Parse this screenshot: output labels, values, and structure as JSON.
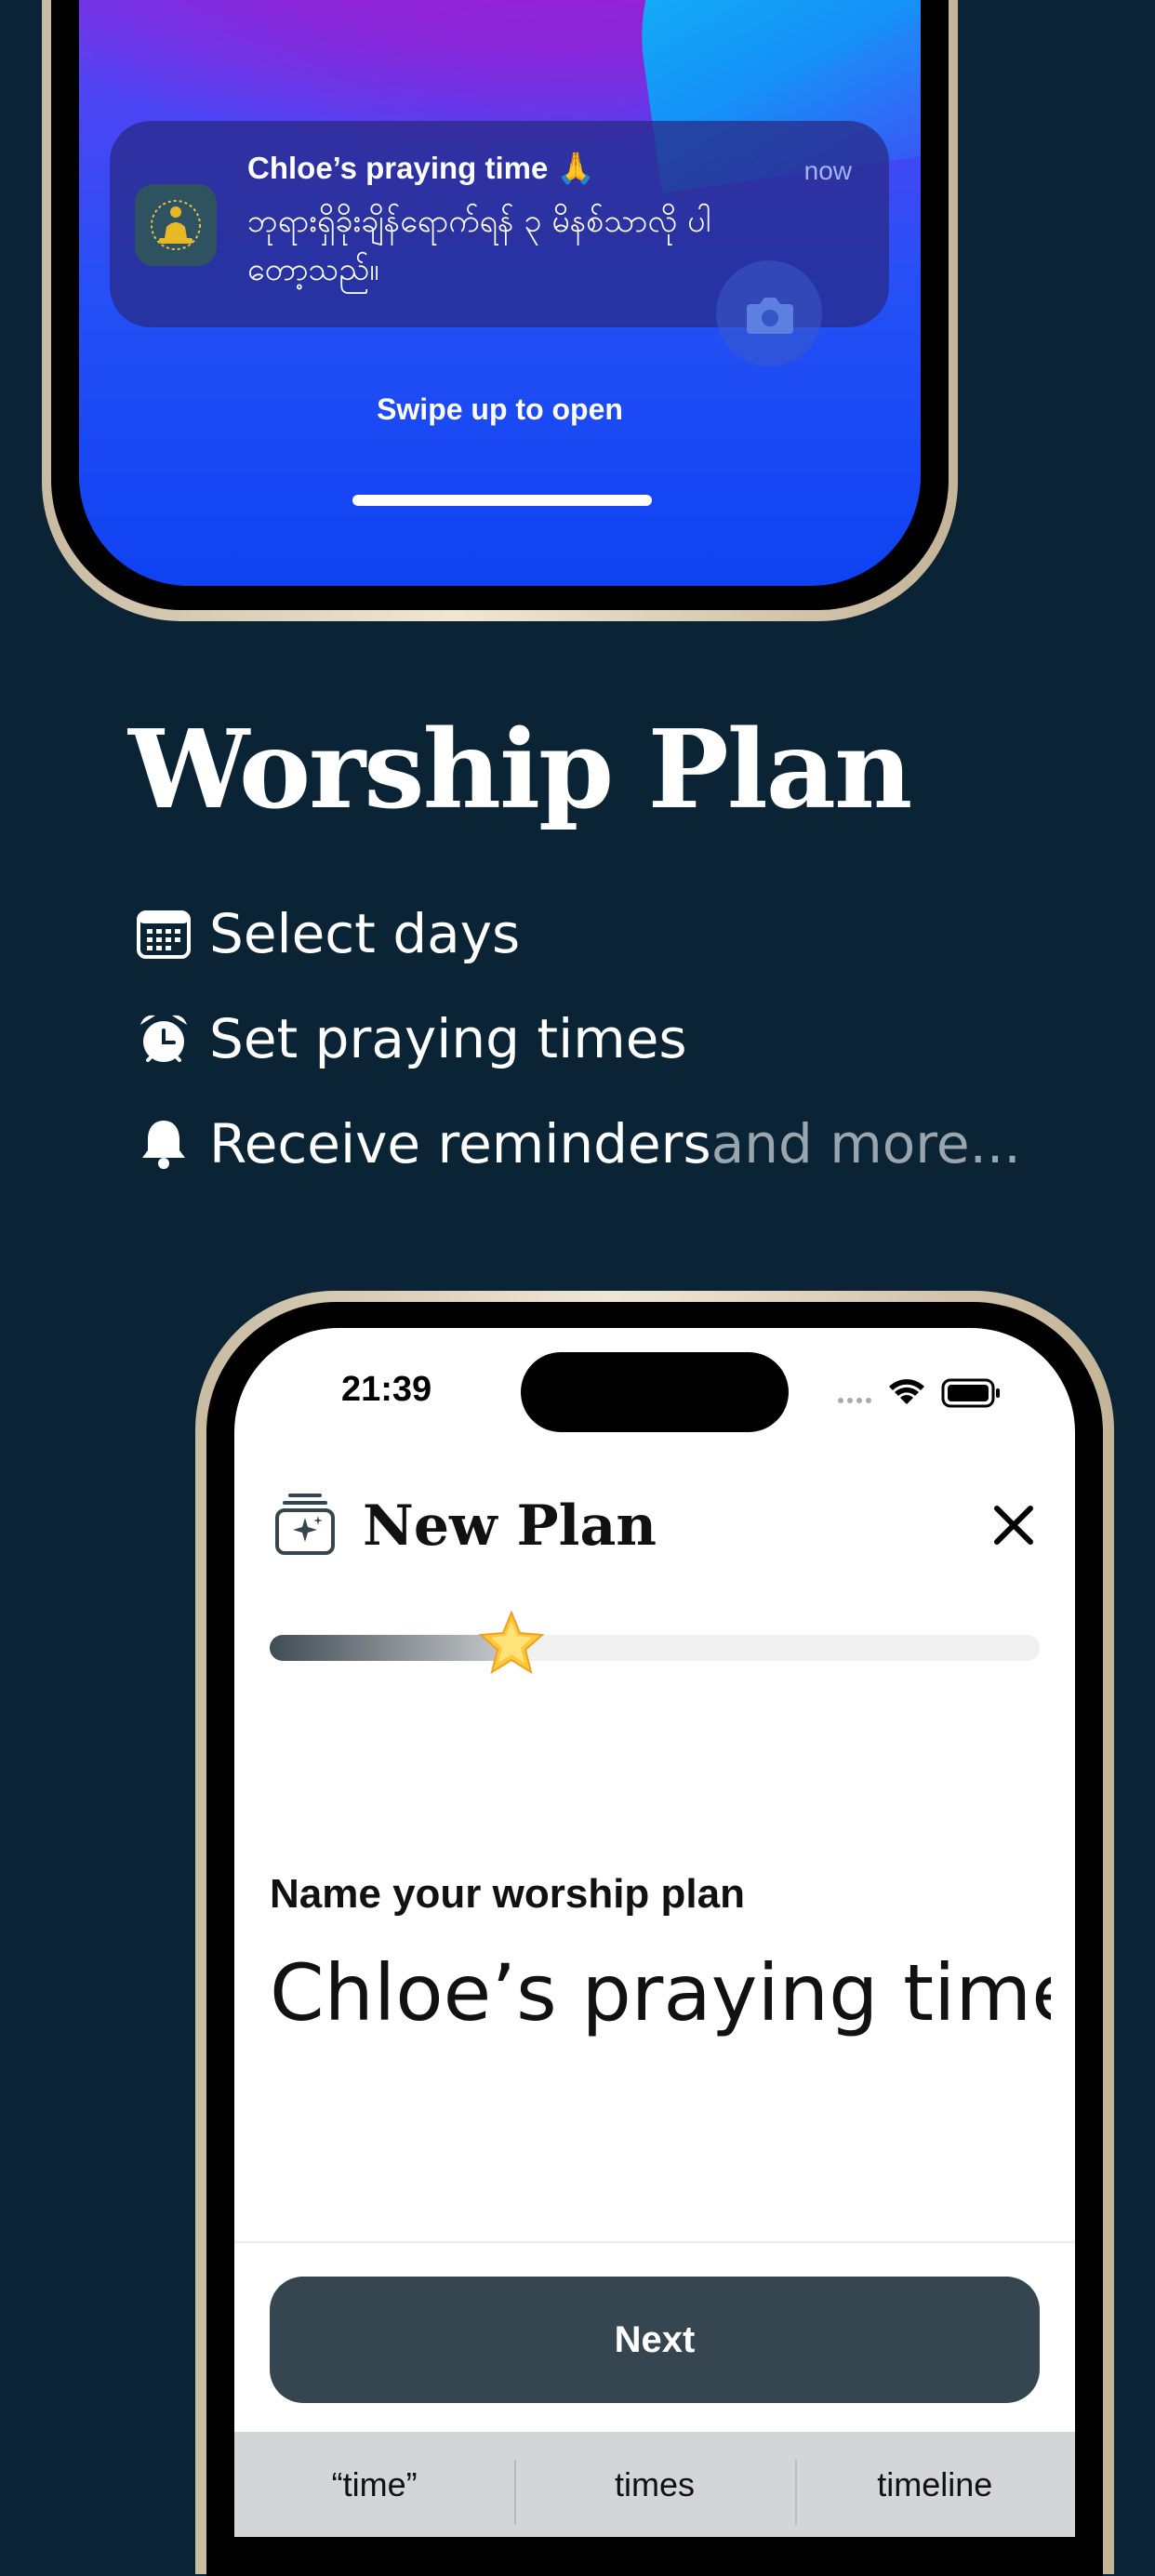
{
  "lock_screen": {
    "notification": {
      "title": "Chloe’s praying time 🙏",
      "time": "now",
      "body": "ဘုရားရှိခိုးချိန်ရောက်ရန် ၃ မိနစ်သာလို ပါတော့သည်။"
    },
    "swipe_text": "Swipe up to open"
  },
  "headline": "Worship Plan",
  "features": [
    {
      "icon": "calendar-icon",
      "text": "Select days"
    },
    {
      "icon": "alarm-clock-icon",
      "text": "Set praying times"
    },
    {
      "icon": "bell-icon",
      "text": "Receive reminders",
      "more": " and more..."
    }
  ],
  "app": {
    "status": {
      "time": "21:39"
    },
    "header": {
      "title": "New Plan"
    },
    "progress": {
      "value": 0.31
    },
    "form": {
      "label": "Name your worship plan",
      "value": "Chloe’s praying time"
    },
    "next_label": "Next",
    "keyboard_suggestions": [
      "“time”",
      "times",
      "timeline"
    ]
  },
  "colors": {
    "background": "#0a2435",
    "button": "#354650",
    "accent_muted": "#9aa5ad"
  }
}
